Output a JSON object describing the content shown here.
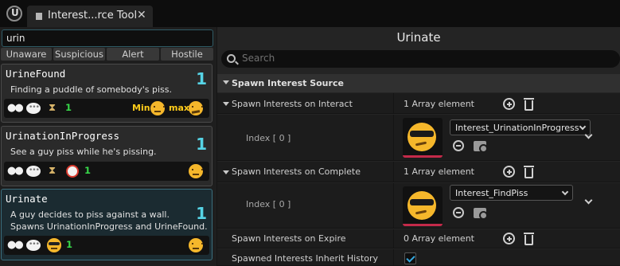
{
  "window": {
    "tab_title": "Interest...rce Tool",
    "close_glyph": "✕"
  },
  "left_panel": {
    "filter_value": "urin",
    "states": [
      "Unaware",
      "Suspicious",
      "Alert",
      "Hostile"
    ],
    "cards": [
      {
        "title": "UrineFound",
        "description": [
          "Finding a puddle of somebody's piss."
        ],
        "count": "1",
        "duration": "1",
        "min_label": "Min",
        "max_label": "max",
        "icons": [
          "eyes-icon",
          "speech-bubble-icon",
          "hourglass-icon"
        ]
      },
      {
        "title": "UrinationInProgress",
        "description": [
          "See a guy piss while he's pissing."
        ],
        "count": "1",
        "duration": "1",
        "icons": [
          "eyes-icon",
          "speech-bubble-icon",
          "hourglass-icon",
          "alarm-clock-icon"
        ]
      },
      {
        "title": "Urinate",
        "description": [
          "A guy decides to piss against a wall.",
          "Spawns UrinationInProgress and UrineFound."
        ],
        "count": "1",
        "duration": "1",
        "icons": [
          "eyes-icon",
          "speech-bubble-icon",
          "cool-face-icon"
        ]
      }
    ]
  },
  "details": {
    "title": "Urinate",
    "search_placeholder": "Search",
    "section_label": "Spawn Interest Source",
    "rows": {
      "on_interact": {
        "label": "Spawn Interests on Interact",
        "value": "1 Array element"
      },
      "interact_index": {
        "label": "Index [ 0 ]",
        "asset": "Interest_UrinationInProgress"
      },
      "on_complete": {
        "label": "Spawn Interests on Complete",
        "value": "1 Array element"
      },
      "complete_index": {
        "label": "Index [ 0 ]",
        "asset": "Interest_FindPiss"
      },
      "on_expire": {
        "label": "Spawn Interests on Expire",
        "value": "0 Array element"
      },
      "inherit_history": {
        "label": "Spawned Interests Inherit History",
        "checked": true
      }
    }
  },
  "colors": {
    "accent_cyan": "#56d4e6",
    "count_green": "#38d94a",
    "label_yellow": "#ffcc1a",
    "selection_border": "#3b6e7d"
  }
}
